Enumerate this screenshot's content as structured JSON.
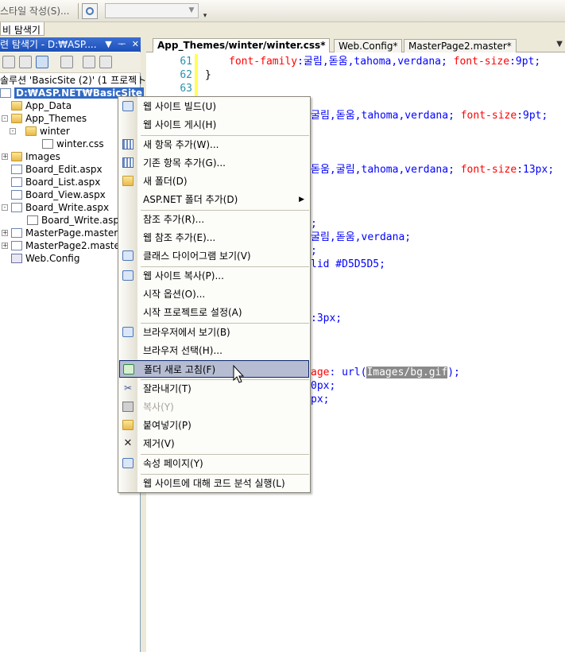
{
  "toolbar": {
    "style_label": "스타일 작성(S)...",
    "combo_value": ""
  },
  "explorer_tab": {
    "label": "비 탐색기"
  },
  "solution_explorer": {
    "title": "련 탐색기 - D:₩ASP....",
    "title_controls": [
      "▼",
      "ᅮ",
      "✕"
    ],
    "tree": {
      "solution": "솔루션 'BasicSite (2)' (1 프로젝ト",
      "root": "D:₩ASP.NET₩BasicSite",
      "items": [
        {
          "label": "App_Data",
          "icon": "folder-icon"
        },
        {
          "label": "App_Themes",
          "icon": "folder-icon"
        },
        {
          "label": "winter",
          "icon": "folder-icon"
        },
        {
          "label": "winter.css",
          "icon": "css-file-icon"
        },
        {
          "label": "Images",
          "icon": "folder-icon"
        },
        {
          "label": "Board_Edit.aspx",
          "icon": "aspx-file-icon"
        },
        {
          "label": "Board_List.aspx",
          "icon": "aspx-file-icon"
        },
        {
          "label": "Board_View.aspx",
          "icon": "aspx-file-icon"
        },
        {
          "label": "Board_Write.aspx",
          "icon": "aspx-file-icon"
        },
        {
          "label": "Board_Write.aspx",
          "icon": "cs-file-icon"
        },
        {
          "label": "MasterPage.master",
          "icon": "master-file-icon"
        },
        {
          "label": "MasterPage2.maste",
          "icon": "master-file-icon"
        },
        {
          "label": "Web.Config",
          "icon": "config-file-icon"
        }
      ]
    }
  },
  "editor": {
    "tabs": [
      "App_Themes/winter/winter.css*",
      "Web.Config*",
      "MasterPage2.master*"
    ],
    "line_numbers": [
      "61",
      "62",
      "63"
    ],
    "lines": [
      {
        "prop": "font-family",
        "rest": ":굴림,돋움,tahoma,verdana; ",
        "prop2": "font-size",
        "val": ":9pt;"
      },
      {
        "text": "}"
      },
      {
        "frag1": "굴림,돋움,tahoma,verdana; ",
        "prop": "font-size",
        "val": ":9pt;"
      },
      {
        "frag1": "돋움,굴림,tahoma,verdana; ",
        "prop": "font-size",
        "val": ":13px;"
      },
      {
        "text": ";"
      },
      {
        "text": "굴림,돋움,verdana;"
      },
      {
        "text": ";"
      },
      {
        "text": "lid #D5D5D5;"
      },
      {
        "text": ":3px;"
      },
      {
        "frag1": "age",
        "mid": ": url(",
        "hl": "Images/bg.gif",
        "end": ");"
      },
      {
        "text": "0px;"
      },
      {
        "text": "px;"
      }
    ]
  },
  "context_menu": {
    "items": [
      {
        "label": "웹 사이트 빌드(U)",
        "icon": "build-icon"
      },
      {
        "label": "웹 사이트 게시(H)",
        "icon": ""
      },
      {
        "label": "새 항목 추가(W)...",
        "icon": "add-new-item-icon"
      },
      {
        "label": "기존 항목 추가(G)...",
        "icon": "add-existing-item-icon"
      },
      {
        "label": "새 폴더(D)",
        "icon": "new-folder-icon"
      },
      {
        "label": "ASP.NET 폴더 추가(D)",
        "icon": ""
      },
      {
        "label": "참조 추가(R)...",
        "icon": ""
      },
      {
        "label": "웹 참조 추가(E)...",
        "icon": ""
      },
      {
        "label": "클래스 다이어그램 보기(V)",
        "icon": "class-diagram-icon"
      },
      {
        "label": "웹 사이트 복사(P)...",
        "icon": "copy-website-icon"
      },
      {
        "label": "시작 옵션(O)...",
        "icon": ""
      },
      {
        "label": "시작 프로젝트로 설정(A)",
        "icon": ""
      },
      {
        "label": "브라우저에서 보기(B)",
        "icon": "view-in-browser-icon"
      },
      {
        "label": "브라우저 선택(H)...",
        "icon": ""
      },
      {
        "label": "폴더 새로 고침(F)",
        "icon": "refresh-icon"
      },
      {
        "label": "잘라내기(T)",
        "icon": "cut-icon"
      },
      {
        "label": "복사(Y)",
        "icon": "copy-icon"
      },
      {
        "label": "붙여넣기(P)",
        "icon": "paste-icon"
      },
      {
        "label": "제거(V)",
        "icon": "delete-icon"
      },
      {
        "label": "속성 페이지(Y)",
        "icon": "properties-icon"
      },
      {
        "label": "웹 사이트에 대해 코드 분석 실행(L)",
        "icon": ""
      }
    ]
  },
  "colors": {
    "selection": "#316ac5",
    "menu_hover": "#b6bdd2",
    "line_number": "#2b91af",
    "css_property": "#ff0000",
    "css_value": "#0000ff"
  }
}
